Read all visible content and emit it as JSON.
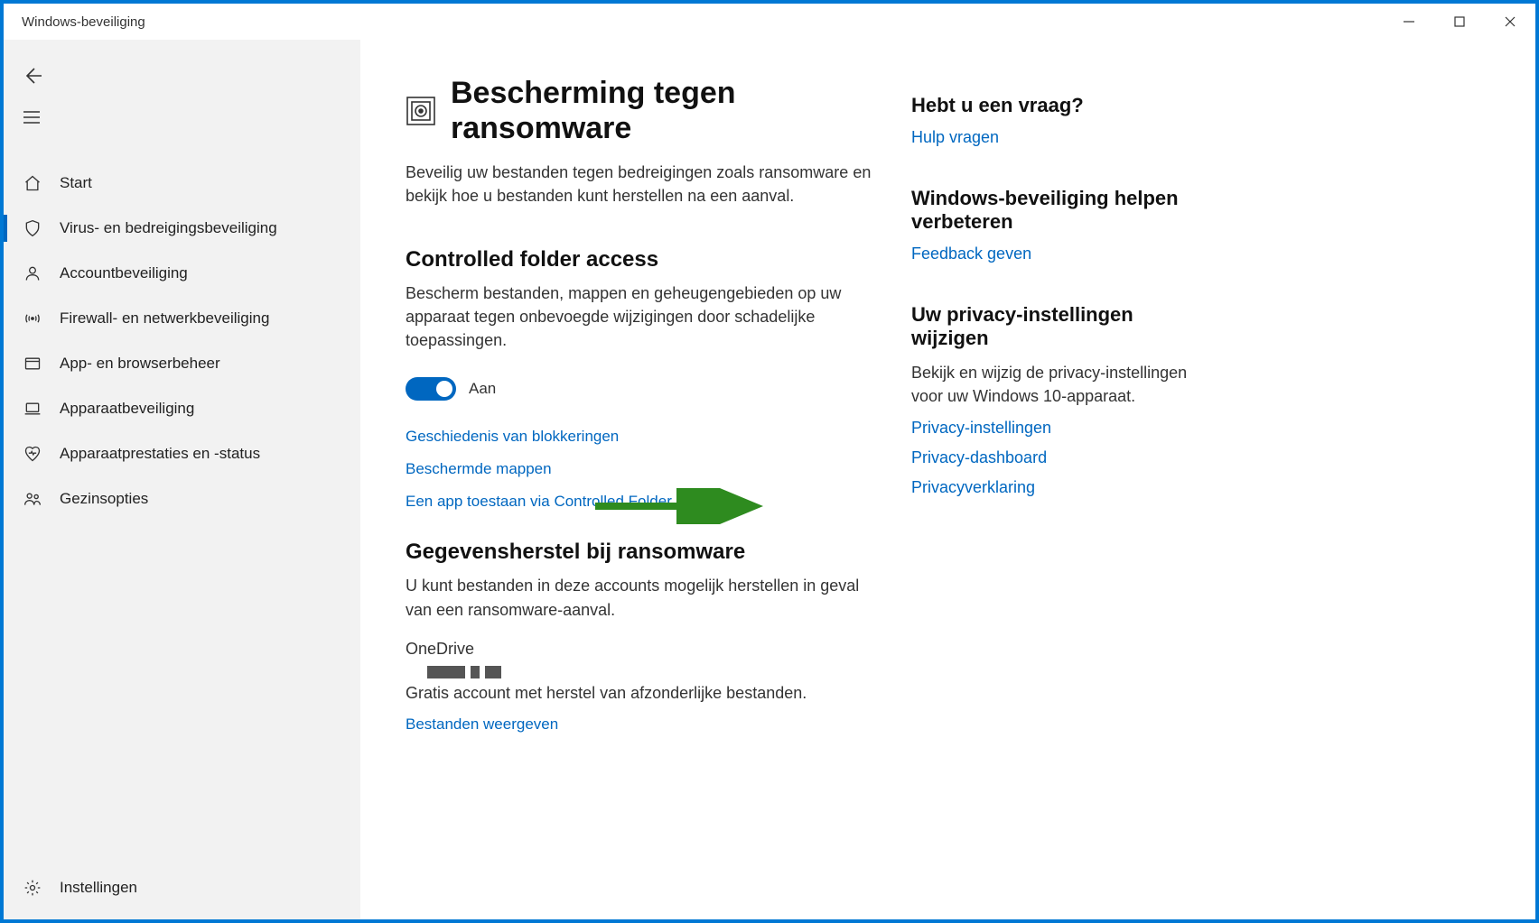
{
  "titlebar": {
    "title": "Windows-beveiliging"
  },
  "sidebar": {
    "items": [
      {
        "label": "Start"
      },
      {
        "label": "Virus- en bedreigingsbeveiliging"
      },
      {
        "label": "Accountbeveiliging"
      },
      {
        "label": "Firewall- en netwerkbeveiliging"
      },
      {
        "label": "App- en browserbeheer"
      },
      {
        "label": "Apparaatbeveiliging"
      },
      {
        "label": "Apparaatprestaties en -status"
      },
      {
        "label": "Gezinsopties"
      }
    ],
    "footer": {
      "label": "Instellingen"
    }
  },
  "page": {
    "title": "Bescherming tegen ransomware",
    "description": "Beveilig uw bestanden tegen bedreigingen zoals ransomware en bekijk hoe u bestanden kunt herstellen na een aanval.",
    "sections": {
      "cfa": {
        "title": "Controlled folder access",
        "description": "Bescherm bestanden, mappen en geheugengebieden op uw apparaat tegen onbevoegde wijzigingen door schadelijke toepassingen.",
        "toggle_label": "Aan",
        "links": [
          "Geschiedenis van blokkeringen",
          "Beschermde mappen",
          "Een app toestaan via Controlled Folder Access"
        ]
      },
      "recovery": {
        "title": "Gegevensherstel bij ransomware",
        "description": "U kunt bestanden in deze accounts mogelijk herstellen in geval van een ransomware-aanval.",
        "onedrive_title": "OneDrive",
        "onedrive_desc": "Gratis account met herstel van afzonderlijke bestanden.",
        "view_files": "Bestanden weergeven"
      }
    }
  },
  "aside": {
    "help": {
      "title": "Hebt u een vraag?",
      "link": "Hulp vragen"
    },
    "improve": {
      "title": "Windows-beveiliging helpen verbeteren",
      "link": "Feedback geven"
    },
    "privacy": {
      "title": "Uw privacy-instellingen wijzigen",
      "text": "Bekijk en wijzig de privacy-instellingen voor uw Windows 10-apparaat.",
      "links": [
        "Privacy-instellingen",
        "Privacy-dashboard",
        "Privacyverklaring"
      ]
    }
  }
}
